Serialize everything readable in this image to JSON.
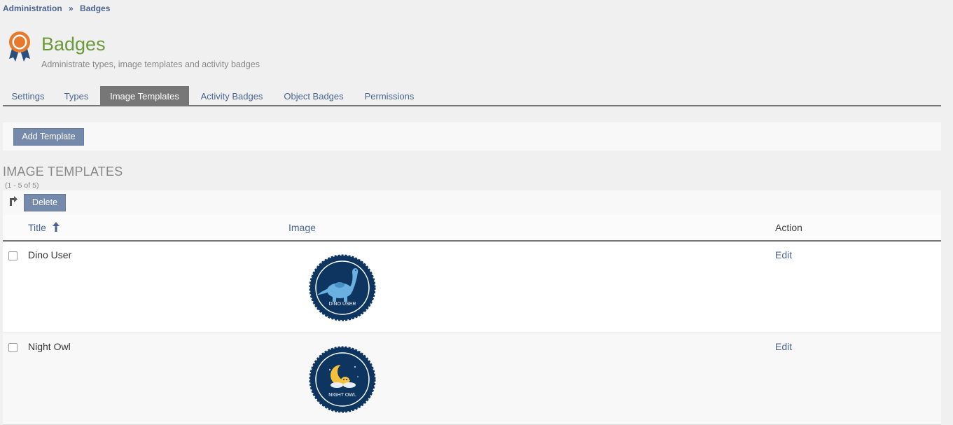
{
  "breadcrumb": {
    "items": [
      "Administration",
      "Badges"
    ],
    "separator": "»"
  },
  "header": {
    "title": "Badges",
    "description": "Administrate types, image templates and activity badges"
  },
  "tabs": [
    {
      "label": "Settings"
    },
    {
      "label": "Types"
    },
    {
      "label": "Image Templates",
      "active": true
    },
    {
      "label": "Activity Badges"
    },
    {
      "label": "Object Badges"
    },
    {
      "label": "Permissions"
    }
  ],
  "toolbar": {
    "add_label": "Add Template"
  },
  "section": {
    "title": "IMAGE TEMPLATES",
    "count": "(1 - 5 of 5)"
  },
  "actions": {
    "delete_label": "Delete"
  },
  "table": {
    "headers": {
      "title": "Title",
      "image": "Image",
      "action": "Action"
    },
    "rows": [
      {
        "title": "Dino User",
        "badge_text": "DINO USER",
        "action": "Edit",
        "icon": "dinosaur-badge-icon"
      },
      {
        "title": "Night Owl",
        "badge_text": "NIGHT OWL",
        "action": "Edit",
        "icon": "moon-badge-icon"
      }
    ]
  },
  "colors": {
    "accent": "#4a6591",
    "title_green": "#6a9a3a",
    "button": "#7589ab",
    "tab_active": "#777777",
    "badge_navy": "#0d3560"
  }
}
